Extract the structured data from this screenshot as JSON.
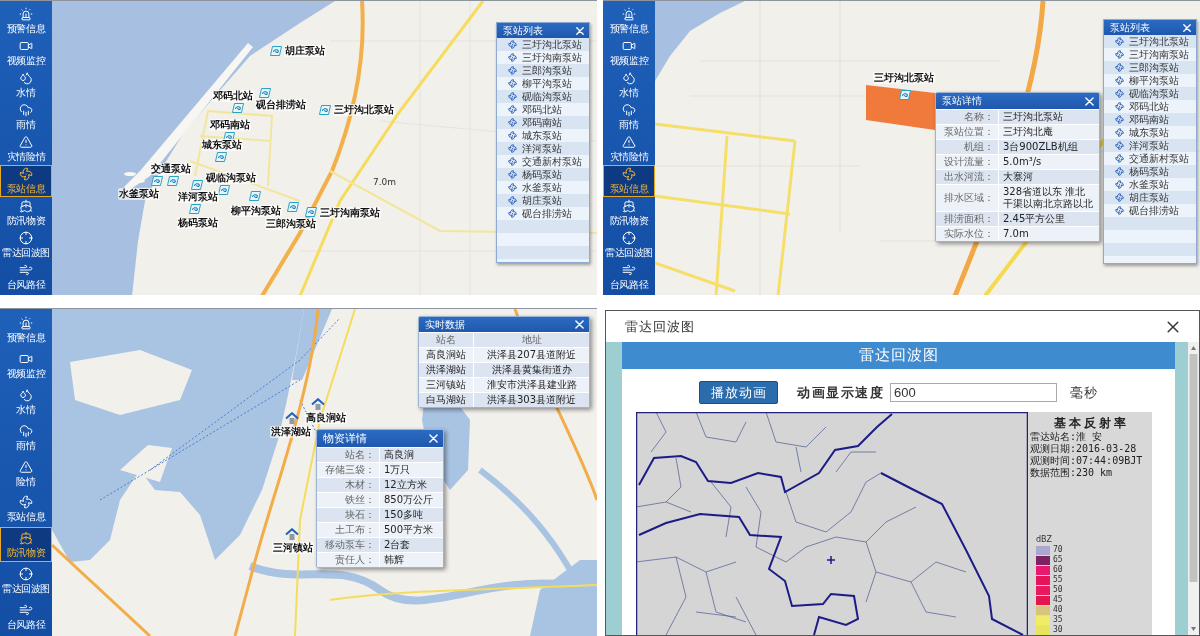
{
  "pump_station_map": {
    "sidebar": [
      {
        "label": "预警信息",
        "selected": false
      },
      {
        "label": "视频监控",
        "selected": false
      },
      {
        "label": "水情",
        "selected": false
      },
      {
        "label": "雨情",
        "selected": false
      },
      {
        "label": "灾情险情",
        "selected": false
      },
      {
        "label": "泵站信息",
        "selected": true
      },
      {
        "label": "防汛物资",
        "selected": false
      },
      {
        "label": "雷达回波图",
        "selected": false
      },
      {
        "label": "台风路径",
        "selected": false
      }
    ],
    "markers": [
      {
        "label": "胡庄泵站"
      },
      {
        "label": "砚台排涝站"
      },
      {
        "label": "邓码北站"
      },
      {
        "label": "邓码南站"
      },
      {
        "label": "城东泵站"
      },
      {
        "label": "交通泵站"
      },
      {
        "label": "水釜泵站"
      },
      {
        "label": "砚临沟泵站"
      },
      {
        "label": "洋河泵站"
      },
      {
        "label": "柳平沟泵站"
      },
      {
        "label": "杨码泵站"
      },
      {
        "label": "三郎沟泵站"
      },
      {
        "label": "三圩沟北泵站"
      },
      {
        "label": "三圩沟南泵站"
      }
    ],
    "water_level_label": "7.0m",
    "station_list": {
      "title": "泵站列表",
      "items": [
        "三圩沟北泵站",
        "三圩沟南泵站",
        "三郎沟泵站",
        "柳平沟泵站",
        "砚临沟泵站",
        "邓码北站",
        "邓码南站",
        "城东泵站",
        "洋河泵站",
        "交通新村泵站",
        "杨码泵站",
        "水釜泵站",
        "胡庄泵站",
        "砚台排涝站"
      ]
    }
  },
  "pump_station_detail_map": {
    "sidebar": [
      {
        "label": "预警信息",
        "selected": false
      },
      {
        "label": "视频监控",
        "selected": false
      },
      {
        "label": "水情",
        "selected": false
      },
      {
        "label": "雨情",
        "selected": false
      },
      {
        "label": "灾情险情",
        "selected": false
      },
      {
        "label": "泵站信息",
        "selected": true
      },
      {
        "label": "防汛物资",
        "selected": false
      },
      {
        "label": "雷达回波图",
        "selected": false
      },
      {
        "label": "台风路径",
        "selected": false
      }
    ],
    "marker": {
      "label": "三圩沟北泵站"
    },
    "detail_popup": {
      "title": "泵站详情",
      "rows": [
        {
          "label": "名称：",
          "value": "三圩沟北泵站"
        },
        {
          "label": "泵站位置：",
          "value": "三圩沟北庵"
        },
        {
          "label": "机组：",
          "value": "3台900ZLB机组"
        },
        {
          "label": "设计流量：",
          "value": "5.0m³/s"
        },
        {
          "label": "出水河流：",
          "value": "大寨河"
        },
        {
          "label": "排水区域：",
          "value": "328省道以东 淮北干渠以南北京路以北"
        },
        {
          "label": "排涝面积：",
          "value": "2.45平方公里"
        },
        {
          "label": "实际水位：",
          "value": "7.0m"
        }
      ]
    },
    "station_list": {
      "title": "泵站列表",
      "items": [
        "三圩沟北泵站",
        "三圩沟南泵站",
        "三郎沟泵站",
        "柳平沟泵站",
        "砚临沟泵站",
        "邓码北站",
        "邓码南站",
        "城东泵站",
        "洋河泵站",
        "交通新村泵站",
        "杨码泵站",
        "水釜泵站",
        "胡庄泵站",
        "砚台排涝站"
      ]
    }
  },
  "supplies_map": {
    "sidebar": [
      {
        "label": "预警信息",
        "selected": false
      },
      {
        "label": "视频监控",
        "selected": false
      },
      {
        "label": "水情",
        "selected": false
      },
      {
        "label": "雨情",
        "selected": false
      },
      {
        "label": "险情",
        "selected": false
      },
      {
        "label": "泵站信息",
        "selected": false
      },
      {
        "label": "防汛物资",
        "selected": true
      },
      {
        "label": "雷达回波图",
        "selected": false
      },
      {
        "label": "台风路径",
        "selected": false
      }
    ],
    "realtime_panel": {
      "title": "实时数据",
      "columns": [
        "站名",
        "地址"
      ],
      "rows": [
        [
          "高良涧站",
          "洪泽县207县道附近"
        ],
        [
          "洪泽湖站",
          "洪泽县黄集街道办"
        ],
        [
          "三河镇站",
          "淮安市洪泽县建业路"
        ],
        [
          "白马湖站",
          "洪泽县303县道附近"
        ]
      ]
    },
    "markers": [
      {
        "label": "高良涧站"
      },
      {
        "label": "洪泽湖站"
      },
      {
        "label": "三河镇站"
      }
    ],
    "supplies_popup": {
      "title": "物资详情",
      "rows": [
        {
          "label": "站名：",
          "value": "高良涧"
        },
        {
          "label": "存储三袋：",
          "value": "1万只"
        },
        {
          "label": "木材：",
          "value": "12立方米"
        },
        {
          "label": "铁丝：",
          "value": "850万公斤"
        },
        {
          "label": "块石：",
          "value": "150多吨"
        },
        {
          "label": "土工布：",
          "value": "500平方米"
        },
        {
          "label": "移动泵车：",
          "value": "2台套"
        },
        {
          "label": "责任人：",
          "value": "韩辉"
        }
      ]
    }
  },
  "radar_dialog": {
    "title": "雷达回波图",
    "header": "雷达回波图",
    "play_button": "播放动画",
    "speed_label": "动画显示速度",
    "speed_input": {
      "value": "600"
    },
    "speed_unit": "毫秒",
    "radar_info": {
      "title": "基本反射率",
      "lines": [
        "雷达站名:淮 安",
        "观测日期:2016-03-28",
        "观测时间:07:44:09BJT",
        "数据范围:230 km"
      ]
    },
    "legend": {
      "unit": "dBZ",
      "entries": [
        {
          "value": "70",
          "color": "#aba7d1"
        },
        {
          "value": "65",
          "color": "#7e2264"
        },
        {
          "value": "60",
          "color": "#e81a6e"
        },
        {
          "value": "55",
          "color": "#e5145a"
        },
        {
          "value": "50",
          "color": "#e8195f"
        },
        {
          "value": "45",
          "color": "#e31652"
        },
        {
          "value": "40",
          "color": "#d8c57c"
        },
        {
          "value": "35",
          "color": "#efec6a"
        },
        {
          "value": "30",
          "color": "#e9e45e"
        }
      ]
    }
  }
}
